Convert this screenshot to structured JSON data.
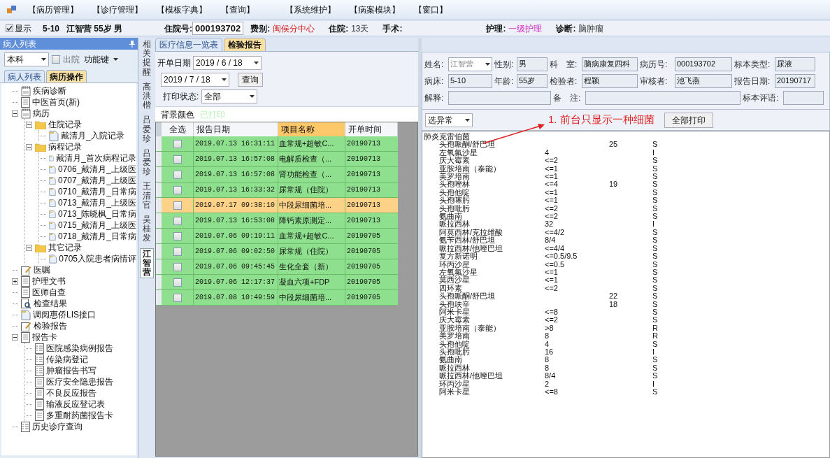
{
  "menu": [
    "【病历管理】",
    "【诊疗管理】",
    "【模板字典】",
    "【查询】",
    "【系统维护】",
    "【病案模块】",
    "【窗口】"
  ],
  "info_bar": {
    "show": {
      "label": "显示",
      "checked": true
    },
    "bed": "5-10",
    "patient": "江智营 55岁 男",
    "admission_no": {
      "label": "住院号:",
      "value": "000193702"
    },
    "fields": [
      {
        "label": "费别:",
        "value": "闽侯分中心",
        "kind": "alert"
      },
      {
        "label": "住院:",
        "value": "13天",
        "kind": "plain"
      },
      {
        "label": "手术:"
      },
      {
        "label": "护理:",
        "value": "一级护理",
        "kind": "nursing"
      },
      {
        "label": "诊断:",
        "value": "脑肿瘤",
        "kind": "plain"
      }
    ]
  },
  "left_panel": {
    "title": "病人列表",
    "dept": "本科",
    "discharged": {
      "label": "出院",
      "checked": false
    },
    "function_key": "功能键",
    "tabs": [
      {
        "label": "病人列表",
        "selected": false
      },
      {
        "label": "病历操作",
        "selected": true
      }
    ],
    "tree": [
      {
        "label": "疾病诊断",
        "kind": "notebook"
      },
      {
        "label": "中医首页(新)",
        "kind": "document"
      },
      {
        "label": "病历",
        "kind": "notebook",
        "expanded": true,
        "children": [
          {
            "label": "住院记录",
            "kind": "folder",
            "expanded": true,
            "children": [
              {
                "label": "戴清月_入院记录",
                "kind": "page"
              }
            ]
          },
          {
            "label": "病程记录",
            "kind": "folder",
            "expanded": true,
            "children": [
              {
                "label": "戴清月_首次病程记录",
                "kind": "page"
              },
              {
                "label": "0706_戴清月_上级医",
                "kind": "page"
              },
              {
                "label": "0707_戴清月_上级医",
                "kind": "page"
              },
              {
                "label": "0710_戴清月_日常病",
                "kind": "page"
              },
              {
                "label": "0713_戴清月_上级医",
                "kind": "page"
              },
              {
                "label": "0713_陈晓枫_日常病",
                "kind": "page"
              },
              {
                "label": "0715_戴清月_上级医",
                "kind": "page"
              },
              {
                "label": "0718_戴清月_日常病",
                "kind": "page"
              }
            ]
          },
          {
            "label": "其它记录",
            "kind": "folder",
            "expanded": true,
            "children": [
              {
                "label": "0705入院患者病情评",
                "kind": "page"
              }
            ]
          }
        ]
      },
      {
        "label": "医嘱",
        "kind": "pencil"
      },
      {
        "label": "护理文书",
        "kind": "document",
        "expanded": false
      },
      {
        "label": "医师自查",
        "kind": "document"
      },
      {
        "label": "检查结果",
        "kind": "magnifier"
      },
      {
        "label": "调阅惠侨LIS接口",
        "kind": "page"
      },
      {
        "label": "检验报告",
        "kind": "pencil"
      },
      {
        "label": "报告卡",
        "kind": "document",
        "expanded": true,
        "children": [
          {
            "label": "医院感染病例报告",
            "kind": "checklist"
          },
          {
            "label": "传染病登记",
            "kind": "checklist"
          },
          {
            "label": "肿瘤报告书写",
            "kind": "checklist"
          },
          {
            "label": "医疗安全隐患报告",
            "kind": "document"
          },
          {
            "label": "不良反应报告",
            "kind": "document"
          },
          {
            "label": "输液反应登记表",
            "kind": "document"
          },
          {
            "label": "多重耐药菌报告卡",
            "kind": "document"
          }
        ]
      },
      {
        "label": "历史诊疗查询",
        "kind": "checklist"
      }
    ]
  },
  "side_tabs": [
    {
      "label": "相关提醒",
      "selected": false
    },
    {
      "label": "高洪楷",
      "selected": false
    },
    {
      "label": "吕爱珍",
      "selected": false
    },
    {
      "label": "吕爱珍",
      "selected": false
    },
    {
      "label": "王清官",
      "selected": false
    },
    {
      "label": "吴桂发",
      "selected": false
    },
    {
      "label": "江智营",
      "selected": true
    }
  ],
  "tabs": [
    {
      "label": "医疗信息一览表",
      "selected": false
    },
    {
      "label": "检验报告",
      "selected": true
    }
  ],
  "filters": {
    "date_label": "开单日期",
    "date_from": "2019 / 6 / 18",
    "date_to": "2019 / 7 / 18",
    "query": "查询",
    "print_label": "打印状态:",
    "print_value": "全部",
    "bg_label": "背景颜色",
    "legend": {
      "label": "已打印",
      "color": "#b8f0b8"
    }
  },
  "table": {
    "columns": [
      {
        "label": "全选",
        "sorted": false
      },
      {
        "label": "报告日期",
        "sorted": false
      },
      {
        "label": "项目名称",
        "sorted": true
      },
      {
        "label": "开单时间",
        "sorted": false
      }
    ],
    "rows": [
      {
        "date": "2019.07.13 16:31:11",
        "item": "血常规+超敏C...",
        "time": "20190713",
        "checked": false,
        "selected": false
      },
      {
        "date": "2019.07.13 16:57:08",
        "item": "电解质检查（...",
        "time": "20190713",
        "checked": false,
        "selected": false
      },
      {
        "date": "2019.07.13 16:57:08",
        "item": "肾功能检查（...",
        "time": "20190713",
        "checked": false,
        "selected": false
      },
      {
        "date": "2019.07.13 16:33:32",
        "item": "尿常规（住院）",
        "time": "20190713",
        "checked": false,
        "selected": false
      },
      {
        "date": "2019.07.17 09:38:10",
        "item": "中段尿细菌培...",
        "time": "20190713",
        "checked": false,
        "selected": true
      },
      {
        "date": "2019.07.13 16:53:08",
        "item": "降钙素原测定...",
        "time": "20190713",
        "checked": false,
        "selected": false
      },
      {
        "date": "2019.07.06 09:19:11",
        "item": "血常规+超敏C...",
        "time": "20190705",
        "checked": false,
        "selected": false
      },
      {
        "date": "2019.07.06 09:02:50",
        "item": "尿常规（住院）",
        "time": "20190705",
        "checked": false,
        "selected": false
      },
      {
        "date": "2019.07.06 09:45:45",
        "item": "生化全套（新）",
        "time": "20190705",
        "checked": false,
        "selected": false
      },
      {
        "date": "2019.07.06 12:17:37",
        "item": "凝血六项+FDP",
        "time": "20190705",
        "checked": false,
        "selected": false
      },
      {
        "date": "2019.07.08 10:49:59",
        "item": "中段尿细菌培...",
        "time": "20190705",
        "checked": false,
        "selected": false
      }
    ]
  },
  "report_form": {
    "fields": [
      {
        "label": "姓名:",
        "value": "江智营",
        "kind": "select",
        "disabled": true
      },
      {
        "label": "性别:",
        "value": "男",
        "kind": "text"
      },
      {
        "label": "科　室:",
        "value": "脑病康复四科",
        "kind": "text"
      },
      {
        "label": "病历号:",
        "value": "000193702",
        "kind": "text"
      },
      {
        "label": "标本类型:",
        "value": "尿液",
        "kind": "text"
      },
      {
        "label": "病床:",
        "value": "5-10",
        "kind": "text"
      },
      {
        "label": "年龄:",
        "value": "55岁",
        "kind": "text"
      },
      {
        "label": "检验者:",
        "value": "程颖",
        "kind": "text"
      },
      {
        "label": "审核者:",
        "value": "池飞燕",
        "kind": "text"
      },
      {
        "label": "报告日期:",
        "value": "20190717",
        "kind": "text"
      },
      {
        "label": "解释:",
        "kind": "wide"
      },
      {
        "label": "备　注:",
        "kind": "wide"
      },
      {
        "label": "标本评语:",
        "kind": "text"
      }
    ]
  },
  "toolbar": {
    "filter": "选异常",
    "annotation": "1. 前台只显示一种细菌",
    "print_all": "全部打印"
  },
  "result": {
    "organism": "肺炎克雷伯菌",
    "rows": [
      {
        "drug": "头孢哌酮/舒巴坦",
        "zone": "25",
        "interp": "S"
      },
      {
        "drug": "左氧氟沙星",
        "mic": "4",
        "interp": "I"
      },
      {
        "drug": "庆大霉素",
        "mic": "<=2",
        "interp": "S"
      },
      {
        "drug": "亚胺培南（泰能）",
        "mic": "<=1",
        "interp": "S"
      },
      {
        "drug": "美罗培南",
        "mic": "<=1",
        "interp": "S"
      },
      {
        "drug": "头孢唑林",
        "mic": "<=4",
        "zone": "19",
        "interp": "S"
      },
      {
        "drug": "头孢他啶",
        "mic": "<=1",
        "interp": "S"
      },
      {
        "drug": "头孢噻肟",
        "mic": "<=1",
        "interp": "S"
      },
      {
        "drug": "头孢吡肟",
        "mic": "<=2",
        "interp": "S"
      },
      {
        "drug": "氨曲南",
        "mic": "<=2",
        "interp": "S"
      },
      {
        "drug": "哌拉西林",
        "mic": "32",
        "interp": "I"
      },
      {
        "drug": "阿莫西林/克拉维酸",
        "mic": "<=4/2",
        "interp": "S"
      },
      {
        "drug": "氨苄西林/舒巴坦",
        "mic": "8/4",
        "interp": "S"
      },
      {
        "drug": "哌拉西林/他唑巴坦",
        "mic": "<=4/4",
        "interp": "S"
      },
      {
        "drug": "复方新诺明",
        "mic": "<=0.5/9.5",
        "interp": "S"
      },
      {
        "drug": "环丙沙星",
        "mic": "<=0.5",
        "interp": "S"
      },
      {
        "drug": "左氧氟沙星",
        "mic": "<=1",
        "interp": "S"
      },
      {
        "drug": "莫西沙星",
        "mic": "<=1",
        "interp": "S"
      },
      {
        "drug": "四环素",
        "mic": "<=2",
        "interp": "S"
      },
      {
        "drug": "头孢哌酮/舒巴坦",
        "zone": "22",
        "interp": "S"
      },
      {
        "drug": "头孢呋辛",
        "zone": "18",
        "interp": "S"
      },
      {
        "drug": "阿米卡星",
        "mic": "<=8",
        "interp": "S"
      },
      {
        "drug": "庆大霉素",
        "mic": "<=2",
        "interp": "S"
      },
      {
        "drug": "亚胺培南（泰能）",
        "mic": ">8",
        "interp": "R"
      },
      {
        "drug": "美罗培南",
        "mic": "8",
        "interp": "R"
      },
      {
        "drug": "头孢他啶",
        "mic": "4",
        "interp": "S"
      },
      {
        "drug": "头孢吡肟",
        "mic": "16",
        "interp": "I"
      },
      {
        "drug": "氨曲南",
        "mic": "8",
        "interp": "S"
      },
      {
        "drug": "哌拉西林",
        "mic": "8",
        "interp": "S"
      },
      {
        "drug": "哌拉西林/他唑巴坦",
        "mic": "8/4",
        "interp": "S"
      },
      {
        "drug": "环丙沙星",
        "mic": "2",
        "interp": "I"
      },
      {
        "drug": "阿米卡星",
        "mic": "<=8",
        "interp": "S"
      }
    ]
  }
}
